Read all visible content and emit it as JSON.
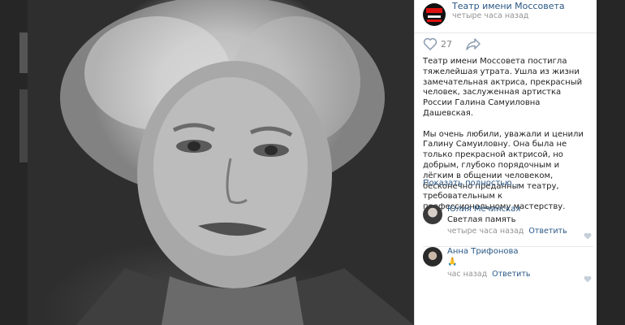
{
  "post": {
    "group_name": "Театр имени Моссовета",
    "time": "четыре часа назад",
    "like_count": "27",
    "paragraph1": "Театр имени Моссовета постигла тяжелейшая утрата. Ушла из жизни замечательная актриса, прекрасный человек, заслуженная артистка России Галина Самуиловна Дашевская.",
    "paragraph2": "Мы очень любили, уважали и ценили Галину Самуиловну. Она была не только прекрасной актрисой, но добрым, глубоко порядочным и лёгким в общении человеком, бесконечно преданным театру, требовательным к профессиональному мастерству.",
    "show_more": "Показать полностью…"
  },
  "comments": [
    {
      "author": "Юлия Мечинская",
      "text": "Светлая память",
      "time": "четыре часа назад",
      "reply": "Ответить"
    },
    {
      "author": "Анна Трифонова",
      "text": "🙏",
      "time": "час назад",
      "reply": "Ответить"
    }
  ],
  "icons": [
    "heart-icon",
    "share-icon",
    "small-heart-icon"
  ],
  "colors": {
    "link": "#2a5885",
    "muted": "#939393",
    "text": "#222222"
  }
}
